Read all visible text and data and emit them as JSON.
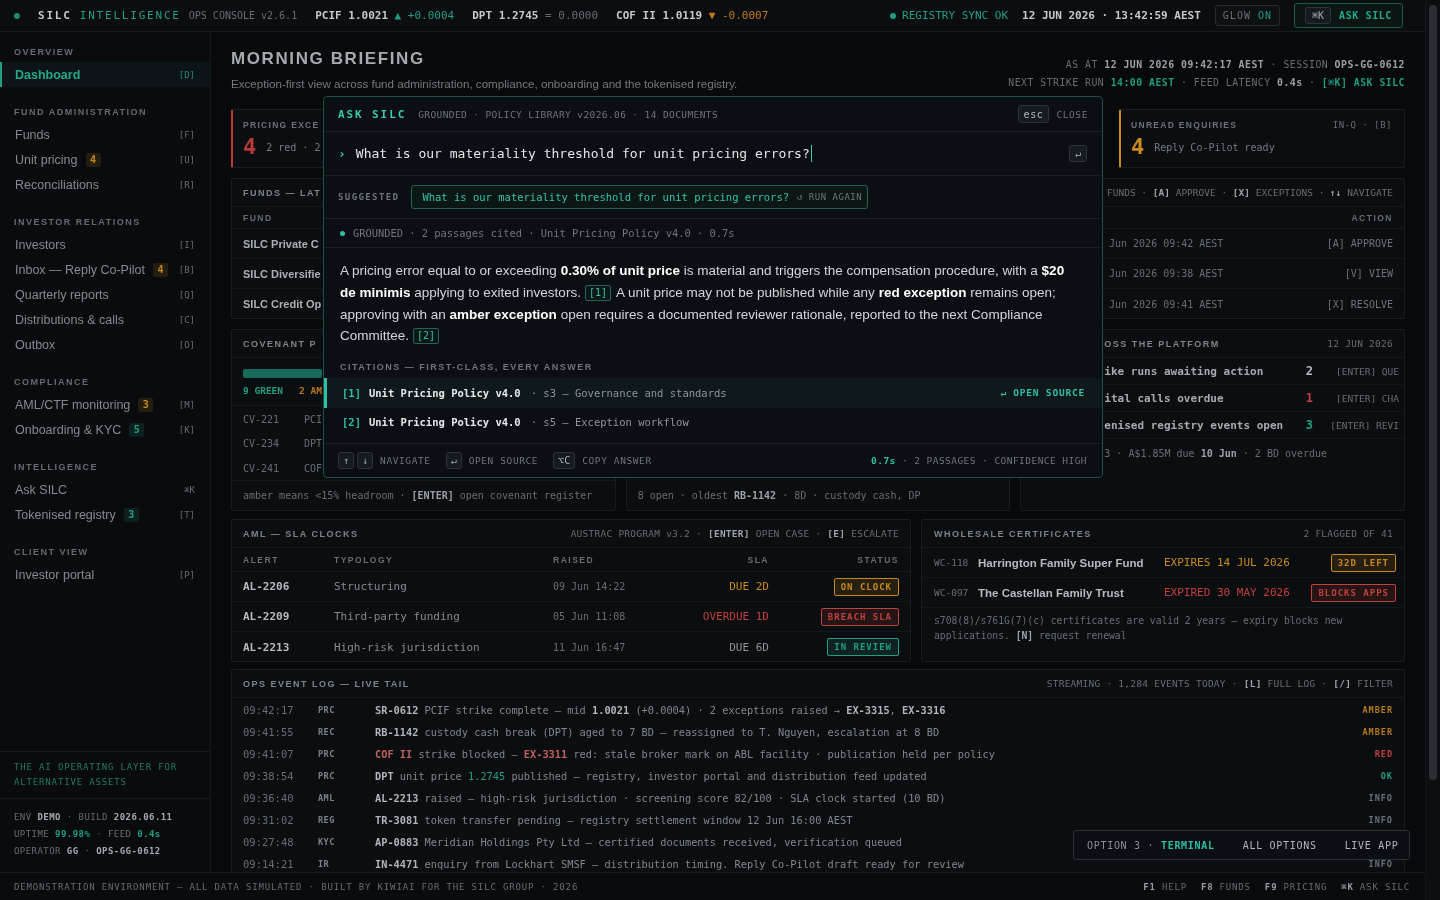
{
  "top_bar": {
    "brand": {
      "name": "SILC",
      "product": "INTELLIGENCE",
      "edition": "OPS CONSOLE v2.6.1"
    },
    "tickers": [
      {
        "quote": "PCIF 1.0021",
        "change": "▲ +0.0004",
        "kind": "up"
      },
      {
        "quote": "DPT 1.2745",
        "change": "= 0.0000",
        "kind": "flat"
      },
      {
        "quote": "COF II 1.0119",
        "change": "▼ -0.0007",
        "kind": "down"
      }
    ],
    "sync": "REGISTRY SYNC OK",
    "datetime": "12 JUN 2026 · 13:42:59 AEST",
    "glow": {
      "label": "GLOW",
      "state": "ON",
      "on": true
    },
    "ask": {
      "key": "⌘K",
      "label": "ASK SILC"
    }
  },
  "sidebar": {
    "sections": [
      {
        "title": "OVERVIEW",
        "items": [
          {
            "label": "Dashboard",
            "key": "[D]",
            "selected": true
          }
        ]
      },
      {
        "title": "FUND ADMINISTRATION",
        "items": [
          {
            "label": "Funds",
            "key": "[F]",
            "selected": false
          },
          {
            "label": "Unit pricing",
            "badge": {
              "text": "4",
              "color": "#c98a1c"
            },
            "key": "[U]",
            "selected": false
          },
          {
            "label": "Reconciliations",
            "key": "[R]",
            "selected": false
          }
        ]
      },
      {
        "title": "INVESTOR RELATIONS",
        "items": [
          {
            "label": "Investors",
            "key": "[I]",
            "selected": false
          },
          {
            "label": "Inbox — Reply Co-Pilot",
            "badge": {
              "text": "4",
              "color": "#c98a1c"
            },
            "key": "[B]",
            "selected": false
          },
          {
            "label": "Quarterly reports",
            "key": "[Q]",
            "selected": false
          },
          {
            "label": "Distributions & calls",
            "key": "[C]",
            "selected": false
          },
          {
            "label": "Outbox",
            "key": "[O]",
            "selected": false
          }
        ]
      },
      {
        "title": "COMPLIANCE",
        "items": [
          {
            "label": "AML/CTF monitoring",
            "badge": {
              "text": "3",
              "color": "#c98a1c"
            },
            "key": "[M]",
            "selected": false
          },
          {
            "label": "Onboarding & KYC",
            "badge": {
              "text": "5",
              "color": "#1fa287"
            },
            "key": "[K]",
            "selected": false
          }
        ]
      },
      {
        "title": "INTELLIGENCE",
        "items": [
          {
            "label": "Ask SILC",
            "key": "⌘K",
            "selected": false
          },
          {
            "label": "Tokenised registry",
            "badge": {
              "text": "3",
              "color": "#1fa287"
            },
            "key": "[T]",
            "selected": false
          }
        ]
      },
      {
        "title": "CLIENT VIEW",
        "items": [
          {
            "label": "Investor portal",
            "key": "[P]",
            "selected": false
          }
        ]
      }
    ],
    "tagline": "THE AI OPERATING LAYER FOR ALTERNATIVE ASSETS",
    "meta": [
      {
        "kind": "info",
        "text": "ENV **DEMO** · BUILD **2026.06.11**"
      },
      {
        "kind": "metric",
        "text": "UPTIME **99.98%** · FEED **0.4s**"
      },
      {
        "kind": "info",
        "text": "OPERATOR **GG** · **OPS-GG-0612**"
      }
    ]
  },
  "header": {
    "title": "MORNING BRIEFING",
    "subtitle": "Exception-first view across fund administration, compliance, onboarding and the tokenised registry.",
    "meta": [
      [
        {
          "text": "AS AT ",
          "kind": "plain"
        },
        {
          "text": "12 JUN 2026 09:42:17 AEST",
          "kind": "strong"
        },
        {
          "text": " · SESSION ",
          "kind": "plain"
        },
        {
          "text": "OPS-GG-0612",
          "kind": "strong"
        }
      ],
      [
        {
          "text": "NEXT STRIKE RUN ",
          "kind": "plain"
        },
        {
          "text": "14:00 AEST",
          "kind": "accent"
        },
        {
          "text": " · FEED LATENCY ",
          "kind": "plain"
        },
        {
          "text": "0.4s",
          "kind": "strong"
        },
        {
          "text": " · ",
          "kind": "plain"
        },
        {
          "text": "[⌘K] ASK SILC",
          "kind": "accent"
        }
      ]
    ]
  },
  "kpi_cards": [
    {
      "label": "PRICING EXCE",
      "value": "4",
      "detail": "2 red · 2",
      "color": "#b83a3a"
    },
    {
      "label": "UNREAD ENQUIRIES",
      "hint": "IN-Q · [B]",
      "value": "4",
      "detail": "Reply Co-Pilot ready",
      "color": "#c98a1c"
    }
  ],
  "funds_panel": {
    "title": "FUNDS — LAT",
    "hint": "FUNDS · **[A]** APPROVE · **[X]** EXCEPTIONS · **↑↓** NAVIGATE",
    "columns": [
      "FUND",
      "ACTION"
    ],
    "rows": [
      {
        "fund": "SILC Private C",
        "updated": "Jun 2026 09:42 AEST",
        "action": "[A] APPROVE"
      },
      {
        "fund": "SILC Diversifie",
        "updated": "Jun 2026 09:38 AEST",
        "action": "[V] VIEW"
      },
      {
        "fund": "SILC Credit Op",
        "updated": "Jun 2026 09:41 AEST",
        "action": "[X] RESOLVE"
      }
    ]
  },
  "covenant_panel": {
    "title": "COVENANT P",
    "legend": [
      {
        "text": "9 GREEN",
        "color": "#1f9e80"
      },
      {
        "text": "2 AM",
        "color": "#b7791f"
      }
    ],
    "rows": [
      {
        "id": "CV-221",
        "fund": "PCI"
      },
      {
        "id": "CV-234",
        "fund": "DPT"
      },
      {
        "id": "CV-241",
        "fund": "COF"
      }
    ],
    "footnote": "amber means <15% headroom · **[ENTER]** open covenant register"
  },
  "middle_panel": {
    "footnote": "8 open · oldest **RB-1142** · 8D · custody cash, DP"
  },
  "platform_panel": {
    "title": "OSS THE PLATFORM",
    "date": "12 JUN 2026",
    "rows": [
      {
        "label": "ike runs awaiting action",
        "count": "2",
        "color": "#b4bac0",
        "action": "[ENTER] QUE"
      },
      {
        "label": "ital calls overdue",
        "count": "1",
        "color": "#c0403a",
        "action": "[ENTER] CHA"
      },
      {
        "label": "enised registry events open",
        "count": "3",
        "color": "#1f9e80",
        "action": "[ENTER] REVI"
      }
    ],
    "footnote": "3 · A$1.85M due **10 Jun** · 2 BD overdue"
  },
  "aml_panel": {
    "title": "AML — SLA CLOCKS",
    "hint": "AUSTRAC PROGRAM v3.2 · **[ENTER]** OPEN CASE · **[E]** ESCALATE",
    "columns": [
      "ALERT",
      "TYPOLOGY",
      "RAISED",
      "SLA",
      "STATUS"
    ],
    "rows": [
      {
        "alert": "AL-2206",
        "typology": "Structuring",
        "raised": "09 Jun 14:22",
        "sla": {
          "text": "DUE 2D",
          "color": "#c98a1c"
        },
        "status": {
          "text": "ON CLOCK",
          "color": "#c98a1c"
        }
      },
      {
        "alert": "AL-2209",
        "typology": "Third-party funding",
        "raised": "05 Jun 11:08",
        "sla": {
          "text": "OVERDUE 1D",
          "color": "#c0403a"
        },
        "status": {
          "text": "BREACH SLA",
          "color": "#c0403a"
        }
      },
      {
        "alert": "AL-2213",
        "typology": "High-risk jurisdiction",
        "raised": "11 Jun 16:47",
        "sla": {
          "text": "DUE 6D",
          "color": "#8d949b"
        },
        "status": {
          "text": "IN REVIEW",
          "color": "#1f9e80"
        }
      }
    ]
  },
  "certificates_panel": {
    "title": "WHOLESALE CERTIFICATES",
    "hint": "2 FLAGGED OF 41",
    "rows": [
      {
        "id": "WC-118",
        "holder": "Harrington Family Super Fund",
        "expiry": {
          "text": "EXPIRES 14 JUL 2026",
          "color": "#c98a1c"
        },
        "badge": {
          "text": "32D LEFT",
          "color": "#c98a1c"
        }
      },
      {
        "id": "WC-097",
        "holder": "The Castellan Family Trust",
        "expiry": {
          "text": "EXPIRED 30 MAY 2026",
          "color": "#c0403a"
        },
        "badge": {
          "text": "BLOCKS APPS",
          "color": "#c0403a"
        }
      }
    ],
    "footnote": "s708(8)/s761G(7)(c) certificates are valid 2 years — expiry blocks new applications. **[N]** request renewal"
  },
  "event_log": {
    "title": "OPS EVENT LOG — LIVE TAIL",
    "hint": "STREAMING · 1,284 EVENTS TODAY · **[L]** FULL LOG · **[/]** FILTER",
    "events": [
      {
        "time": "09:42:17",
        "type": "PRC",
        "message": [
          {
            "text": "SR-0612",
            "kind": "strong"
          },
          {
            "text": " PCIF strike complete — mid ",
            "kind": "plain"
          },
          {
            "text": "1.0021",
            "kind": "strong"
          },
          {
            "text": " (+0.0004) · 2 exceptions raised → ",
            "kind": "plain"
          },
          {
            "text": "EX-3315",
            "kind": "strong"
          },
          {
            "text": ", ",
            "kind": "plain"
          },
          {
            "text": "EX-3316",
            "kind": "strong"
          }
        ],
        "status": {
          "text": "AMBER",
          "color": "#b7791f"
        }
      },
      {
        "time": "09:41:55",
        "type": "REC",
        "message": [
          {
            "text": "RB-1142",
            "kind": "strong"
          },
          {
            "text": " custody cash break (DPT) aged to 7 BD — reassigned to T. Nguyen, escalation at 8 BD",
            "kind": "plain"
          }
        ],
        "status": {
          "text": "AMBER",
          "color": "#b7791f"
        }
      },
      {
        "time": "09:41:07",
        "type": "PRC",
        "message": [
          {
            "text": "COF II",
            "kind": "alert"
          },
          {
            "text": " strike blocked — ",
            "kind": "plain"
          },
          {
            "text": "EX-3311",
            "kind": "alert"
          },
          {
            "text": " red: stale broker mark on ABL facility · publication held per policy",
            "kind": "plain"
          }
        ],
        "status": {
          "text": "RED",
          "color": "#c0403a"
        }
      },
      {
        "time": "09:38:54",
        "type": "PRC",
        "message": [
          {
            "text": "DPT",
            "kind": "strong"
          },
          {
            "text": " unit price ",
            "kind": "plain"
          },
          {
            "text": "1.2745",
            "kind": "accent"
          },
          {
            "text": " published — registry, investor portal and distribution feed updated",
            "kind": "plain"
          }
        ],
        "status": {
          "text": "OK",
          "color": "#1f9e80"
        }
      },
      {
        "time": "09:36:40",
        "type": "AML",
        "message": [
          {
            "text": "AL-2213",
            "kind": "strong"
          },
          {
            "text": " raised — high-risk jurisdiction · screening score 82/100 · SLA clock started (10 BD)",
            "kind": "plain"
          }
        ],
        "status": {
          "text": "INFO",
          "color": "#69707a"
        }
      },
      {
        "time": "09:31:02",
        "type": "REG",
        "message": [
          {
            "text": "TR-3081",
            "kind": "strong"
          },
          {
            "text": " token transfer pending — registry settlement window 12 Jun 16:00 AEST",
            "kind": "plain"
          }
        ],
        "status": {
          "text": "INFO",
          "color": "#69707a"
        }
      },
      {
        "time": "09:27:48",
        "type": "KYC",
        "message": [
          {
            "text": "AP-0883",
            "kind": "strong"
          },
          {
            "text": " Meridian Holdings Pty Ltd — certified documents received, verification queued",
            "kind": "plain"
          }
        ]
      },
      {
        "time": "09:14:21",
        "type": "IR",
        "message": [
          {
            "text": "IN-4471",
            "kind": "strong"
          },
          {
            "text": " enquiry from Lockhart SMSF — distribution timing. Reply Co-Pilot draft ready for review",
            "kind": "plain"
          }
        ],
        "status": {
          "text": "INFO",
          "color": "#69707a"
        }
      }
    ]
  },
  "ask_dialog": {
    "title": "ASK SILC",
    "context": "GROUNDED · POLICY LIBRARY v2026.06 · 14 DOCUMENTS",
    "close": {
      "key": "esc",
      "label": "CLOSE"
    },
    "prompt": "›",
    "query": "What is our materiality threshold for unit pricing errors?",
    "submit_key": "↵",
    "suggested": {
      "label": "SUGGESTED",
      "question": "What is our materiality threshold for unit pricing errors?",
      "rerun": "↺ RUN AGAIN"
    },
    "status": "GROUNDED · 2 passages cited · Unit Pricing Policy v4.0 · 0.7s",
    "answer": [
      {
        "kind": "text",
        "text": "A pricing error equal to or exceeding **0.30% of unit price** is material and triggers the compensation procedure, with a **$20 de minimis** applying to exited investors."
      },
      {
        "kind": "cite",
        "text": "[1]"
      },
      {
        "kind": "text",
        "text": " A unit price may not be published while any **red exception** remains open; approving with an **amber exception** open requires a documented reviewer rationale, reported to the next Compliance Committee."
      },
      {
        "kind": "cite",
        "text": "[2]"
      }
    ],
    "citations_title": "CITATIONS — FIRST-CLASS, EVERY ANSWER",
    "citations": [
      {
        "ref": "[1]",
        "source": "Unit Pricing Policy v4.0",
        "section": "· s3 — Governance and standards",
        "action": "↵ OPEN SOURCE",
        "selected": true
      },
      {
        "ref": "[2]",
        "source": "Unit Pricing Policy v4.0",
        "section": "· s5 — Exception workflow",
        "selected": false
      }
    ],
    "shortcuts": [
      {
        "keys": [
          "↑",
          "↓"
        ],
        "label": "NAVIGATE"
      },
      {
        "keys": [
          "↵"
        ],
        "label": "OPEN SOURCE"
      },
      {
        "keys": [
          "⌥C"
        ],
        "label": "COPY ANSWER"
      }
    ],
    "summary": [
      {
        "text": "0.7s",
        "kind": "accent"
      },
      {
        "text": " · 2 PASSAGES · CONFIDENCE HIGH",
        "kind": "plain"
      }
    ]
  },
  "view_switcher": {
    "current": [
      {
        "text": "OPTION 3 · ",
        "kind": "plain"
      },
      {
        "text": "TERMINAL",
        "kind": "accent"
      }
    ],
    "links": [
      "ALL OPTIONS",
      "LIVE APP"
    ]
  },
  "footer": {
    "notice": "DEMONSTRATION ENVIRONMENT — ALL DATA SIMULATED · BUILT BY KIWIAI FOR THE SILC GROUP · 2026",
    "shortcuts": [
      {
        "key": "F1",
        "label": "HELP"
      },
      {
        "key": "F8",
        "label": "FUNDS"
      },
      {
        "key": "F9",
        "label": "PRICING"
      },
      {
        "key": "⌘K",
        "label": "ASK SILC"
      }
    ]
  }
}
